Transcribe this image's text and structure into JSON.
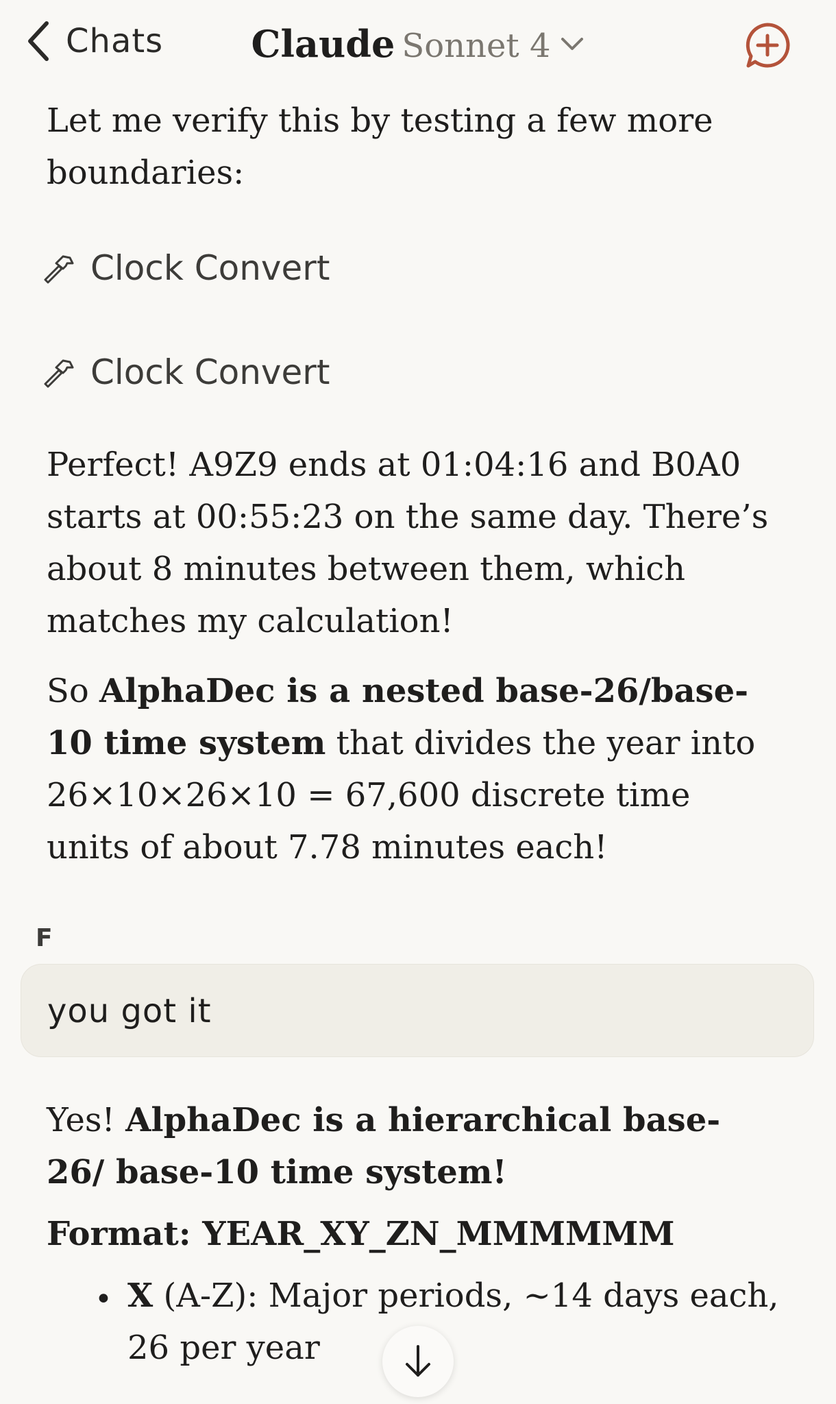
{
  "header": {
    "back_label": "Chats",
    "app_name": "Claude",
    "model_name": "Sonnet 4"
  },
  "messages": {
    "intro": "Let me verify this by testing a few more boundaries:",
    "tools": [
      "Clock Convert",
      "Clock Convert"
    ],
    "para1": "Perfect! A9Z9 ends at 01:04:16 and B0A0 starts at 00:55:23 on the same day. There’s about 8 minutes between them, which matches my calculation!",
    "para2_prefix": "So ",
    "para2_bold": "AlphaDec is a nested base-26/base-10 time system",
    "para2_rest": " that divides the year into 26×10×26×10 = 67,600 discrete time units of about 7.78 minutes each!",
    "user_initial": "F",
    "user_message": "you got it",
    "reply_prefix": "Yes! ",
    "reply_bold": "AlphaDec is a hierarchical base-26/ base-10 time system!",
    "format_line": "Format: YEAR_XY_ZN_MMMMMM",
    "bullet1_key": "X",
    "bullet1_text": " (A-Z): Major periods, ~14 days each, 26 per year"
  },
  "colors": {
    "background": "#f9f8f5",
    "accent": "#b4533a",
    "user_bubble": "#f0eee7"
  },
  "icons": {
    "back": "chevron-left-icon",
    "model_dropdown": "chevron-down-icon",
    "new_chat": "new-chat-icon",
    "tool": "hammer-icon",
    "scroll_down": "arrow-down-icon"
  }
}
